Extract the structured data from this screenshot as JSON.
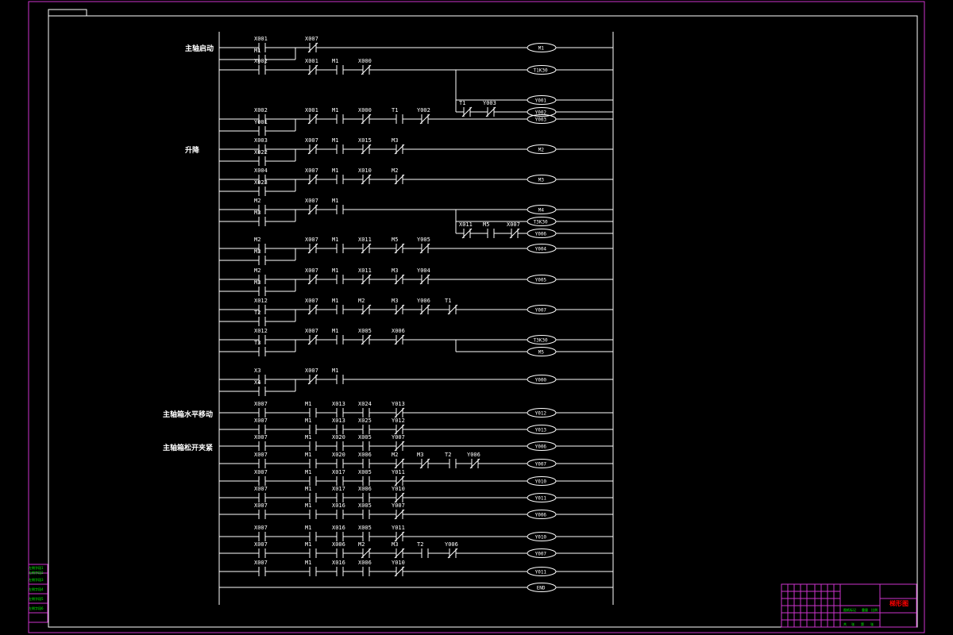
{
  "drawing": {
    "title": "梯形图",
    "frame_color": "#cc33cc",
    "line_color": "#ffffff",
    "tb_text_color": "#00ff00",
    "title_color": "#ff0000"
  },
  "section_labels": [
    "主轴启动",
    "升降",
    "主轴箱水平移动",
    "主轴箱松开夹紧"
  ],
  "title_block": {
    "left_cells": [
      "左侧字段1",
      "左侧字段2",
      "左侧字段3",
      "左侧字段4",
      "左侧字段5",
      "左侧字段6"
    ],
    "scale_row": [
      "图纸标记",
      "重量",
      "比例"
    ],
    "sheet_row": [
      "共",
      "张",
      "第",
      "张"
    ]
  },
  "rungs": [
    {
      "contacts": [
        {
          "l": "X001",
          "t": "NO"
        },
        {
          "l": "X007",
          "t": "NC"
        }
      ],
      "branch": [
        {
          "l": "M1",
          "t": "NO"
        }
      ],
      "coils": [
        "M1"
      ]
    },
    {
      "contacts": [
        {
          "l": "X002",
          "t": "NO"
        },
        {
          "l": "X001",
          "t": "NC"
        },
        {
          "l": "M1",
          "t": "NO"
        },
        {
          "l": "X000",
          "t": "NC"
        }
      ],
      "coils": [
        "T1K30",
        "Y001",
        "Y002"
      ],
      "sub": [
        null,
        null,
        [
          {
            "l": "T1",
            "t": "NC"
          },
          {
            "l": "Y003",
            "t": "NC"
          }
        ]
      ]
    },
    {
      "contacts": [
        {
          "l": "X002",
          "t": "NO"
        },
        {
          "l": "X001",
          "t": "NC"
        },
        {
          "l": "M1",
          "t": "NO"
        },
        {
          "l": "X000",
          "t": "NC"
        },
        {
          "l": "T1",
          "t": "NO"
        },
        {
          "l": "Y002",
          "t": "NC"
        }
      ],
      "branch": [
        {
          "l": "Y001",
          "t": "NO"
        }
      ],
      "coils": [
        "Y003"
      ]
    },
    {
      "contacts": [
        {
          "l": "X003",
          "t": "NO"
        },
        {
          "l": "X007",
          "t": "NC"
        },
        {
          "l": "M1",
          "t": "NO"
        },
        {
          "l": "X015",
          "t": "NC"
        },
        {
          "l": "M3",
          "t": "NC"
        }
      ],
      "branch": [
        {
          "l": "X022",
          "t": "NO"
        }
      ],
      "coils": [
        "M2"
      ]
    },
    {
      "contacts": [
        {
          "l": "X004",
          "t": "NO"
        },
        {
          "l": "X007",
          "t": "NC"
        },
        {
          "l": "M1",
          "t": "NO"
        },
        {
          "l": "X010",
          "t": "NC"
        },
        {
          "l": "M2",
          "t": "NC"
        }
      ],
      "branch": [
        {
          "l": "X023",
          "t": "NO"
        }
      ],
      "coils": [
        "M3"
      ]
    },
    {
      "contacts": [
        {
          "l": "M2",
          "t": "NO"
        },
        {
          "l": "X007",
          "t": "NC"
        },
        {
          "l": "M1",
          "t": "NO"
        }
      ],
      "branch": [
        {
          "l": "M3",
          "t": "NO"
        }
      ],
      "coils": [
        "M4",
        "T3K30",
        "Y006"
      ],
      "sub": [
        null,
        null,
        [
          {
            "l": "X011",
            "t": "NC"
          },
          {
            "l": "M5",
            "t": "NO"
          },
          {
            "l": "X007",
            "t": "NC"
          }
        ]
      ]
    },
    {
      "contacts": [
        {
          "l": "M2",
          "t": "NO"
        },
        {
          "l": "X007",
          "t": "NC"
        },
        {
          "l": "M1",
          "t": "NO"
        },
        {
          "l": "X011",
          "t": "NC"
        },
        {
          "l": "M5",
          "t": "NC"
        },
        {
          "l": "Y005",
          "t": "NC"
        }
      ],
      "branch": [
        {
          "l": "M3",
          "t": "NO"
        }
      ],
      "coils": [
        "Y004"
      ]
    },
    {
      "contacts": [
        {
          "l": "M2",
          "t": "NO"
        },
        {
          "l": "X007",
          "t": "NC"
        },
        {
          "l": "M1",
          "t": "NO"
        },
        {
          "l": "X011",
          "t": "NC"
        },
        {
          "l": "M3",
          "t": "NC"
        },
        {
          "l": "Y004",
          "t": "NC"
        }
      ],
      "branch": [
        {
          "l": "M3",
          "t": "NO"
        }
      ],
      "coils": [
        "Y005"
      ]
    },
    {
      "contacts": [
        {
          "l": "X012",
          "t": "NO"
        },
        {
          "l": "X007",
          "t": "NC"
        },
        {
          "l": "M1",
          "t": "NO"
        },
        {
          "l": "M2",
          "t": "NC"
        },
        {
          "l": "M3",
          "t": "NC"
        },
        {
          "l": "Y006",
          "t": "NC"
        },
        {
          "l": "T1",
          "t": "NC"
        }
      ],
      "branch": [
        {
          "l": "T2",
          "t": "NO"
        }
      ],
      "coils": [
        "Y007"
      ]
    },
    {
      "contacts": [
        {
          "l": "X012",
          "t": "NO"
        },
        {
          "l": "X007",
          "t": "NC"
        },
        {
          "l": "M1",
          "t": "NO"
        },
        {
          "l": "X005",
          "t": "NC"
        },
        {
          "l": "X006",
          "t": "NC"
        }
      ],
      "branch": [
        {
          "l": "T3",
          "t": "NO"
        }
      ],
      "coils": [
        "T3K30",
        "M5"
      ]
    },
    {
      "contacts": [
        {
          "l": "X3",
          "t": "NO"
        },
        {
          "l": "X007",
          "t": "NC"
        },
        {
          "l": "M1",
          "t": "NO"
        }
      ],
      "branch": [
        {
          "l": "X4",
          "t": "NO"
        }
      ],
      "coils": [
        "Y000"
      ]
    },
    {
      "contacts": [
        {
          "l": "X007",
          "t": "NO"
        },
        {
          "l": "M1",
          "t": "NO"
        },
        {
          "l": "X013",
          "t": "NO"
        },
        {
          "l": "X024",
          "t": "NO"
        },
        {
          "l": "Y013",
          "t": "NC"
        }
      ],
      "coils": [
        "Y012"
      ]
    },
    {
      "contacts": [
        {
          "l": "X007",
          "t": "NO"
        },
        {
          "l": "M1",
          "t": "NO"
        },
        {
          "l": "X013",
          "t": "NO"
        },
        {
          "l": "X025",
          "t": "NO"
        },
        {
          "l": "Y012",
          "t": "NC"
        }
      ],
      "coils": [
        "Y013"
      ]
    },
    {
      "contacts": [
        {
          "l": "X007",
          "t": "NO"
        },
        {
          "l": "M1",
          "t": "NO"
        },
        {
          "l": "X020",
          "t": "NO"
        },
        {
          "l": "X005",
          "t": "NO"
        },
        {
          "l": "Y007",
          "t": "NC"
        }
      ],
      "coils": [
        "Y006"
      ]
    },
    {
      "contacts": [
        {
          "l": "X007",
          "t": "NO"
        },
        {
          "l": "M1",
          "t": "NO"
        },
        {
          "l": "X020",
          "t": "NO"
        },
        {
          "l": "X006",
          "t": "NO"
        },
        {
          "l": "M2",
          "t": "NC"
        },
        {
          "l": "M3",
          "t": "NC"
        },
        {
          "l": "T2",
          "t": "NO"
        },
        {
          "l": "Y006",
          "t": "NC"
        }
      ],
      "coils": [
        "Y007"
      ]
    },
    {
      "contacts": [
        {
          "l": "X007",
          "t": "NO"
        },
        {
          "l": "M1",
          "t": "NO"
        },
        {
          "l": "X017",
          "t": "NO"
        },
        {
          "l": "X005",
          "t": "NO"
        },
        {
          "l": "Y011",
          "t": "NC"
        }
      ],
      "coils": [
        "Y010"
      ]
    },
    {
      "contacts": [
        {
          "l": "X007",
          "t": "NO"
        },
        {
          "l": "M1",
          "t": "NO"
        },
        {
          "l": "X017",
          "t": "NO"
        },
        {
          "l": "X006",
          "t": "NO"
        },
        {
          "l": "Y010",
          "t": "NC"
        }
      ],
      "coils": [
        "Y011"
      ]
    },
    {
      "contacts": [
        {
          "l": "X007",
          "t": "NO"
        },
        {
          "l": "M1",
          "t": "NO"
        },
        {
          "l": "X016",
          "t": "NO"
        },
        {
          "l": "X005",
          "t": "NO"
        },
        {
          "l": "Y007",
          "t": "NC"
        }
      ],
      "coils": [
        "Y006"
      ]
    },
    {
      "contacts": [
        {
          "l": "X007",
          "t": "NO"
        },
        {
          "l": "M1",
          "t": "NO"
        },
        {
          "l": "X016",
          "t": "NO"
        },
        {
          "l": "X005",
          "t": "NO"
        },
        {
          "l": "Y011",
          "t": "NC"
        }
      ],
      "coils": [
        "Y010"
      ]
    },
    {
      "contacts": [
        {
          "l": "X007",
          "t": "NO"
        },
        {
          "l": "M1",
          "t": "NO"
        },
        {
          "l": "X006",
          "t": "NO"
        },
        {
          "l": "M2",
          "t": "NC"
        },
        {
          "l": "M3",
          "t": "NC"
        },
        {
          "l": "T2",
          "t": "NO"
        },
        {
          "l": "Y006",
          "t": "NC"
        }
      ],
      "coils": [
        "Y007"
      ]
    },
    {
      "contacts": [
        {
          "l": "X007",
          "t": "NO"
        },
        {
          "l": "M1",
          "t": "NO"
        },
        {
          "l": "X016",
          "t": "NO"
        },
        {
          "l": "X006",
          "t": "NO"
        },
        {
          "l": "Y010",
          "t": "NC"
        }
      ],
      "coils": [
        "Y011"
      ]
    },
    {
      "contacts": [],
      "coils": [
        "END"
      ]
    }
  ]
}
